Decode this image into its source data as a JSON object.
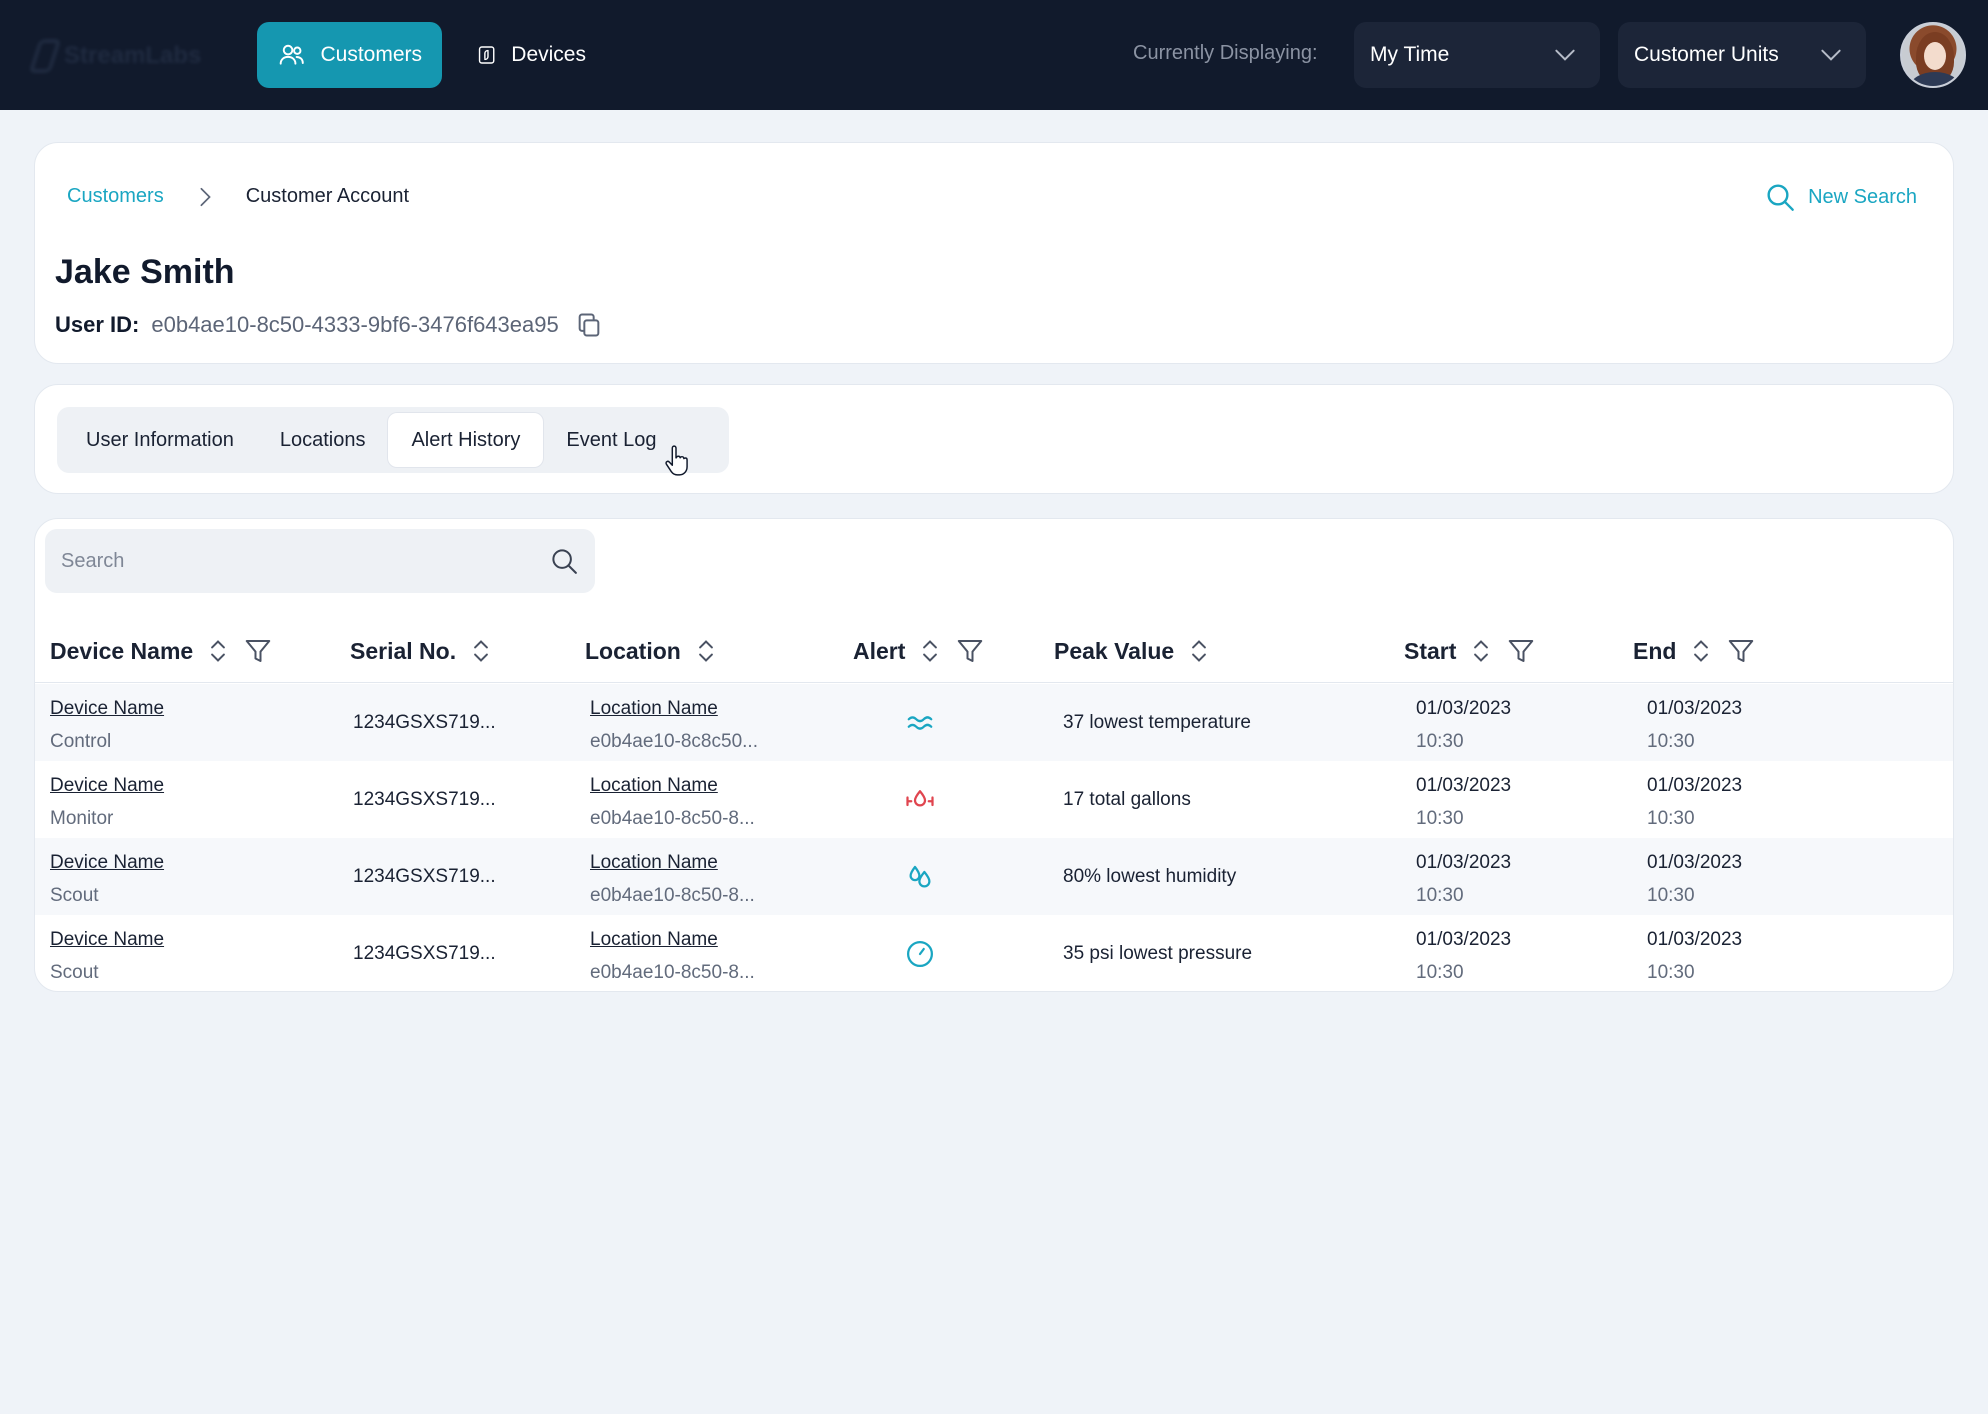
{
  "brand": {
    "name": "StreamLabs"
  },
  "topbar": {
    "nav": [
      {
        "label": "Customers",
        "icon": "users-icon",
        "active": true
      },
      {
        "label": "Devices",
        "icon": "device-icon",
        "active": false
      }
    ],
    "displaying_label": "Currently Displaying:",
    "time_select": "My Time",
    "units_select": "Customer Units"
  },
  "breadcrumb": {
    "parent": "Customers",
    "current": "Customer Account"
  },
  "new_search": "New Search",
  "customer": {
    "name": "Jake Smith",
    "user_id_label": "User ID:",
    "user_id": "e0b4ae10-8c50-4333-9bf6-3476f643ea95"
  },
  "tabs": [
    "User Information",
    "Locations",
    "Alert History",
    "Event Log"
  ],
  "active_tab": "Alert History",
  "table": {
    "search_placeholder": "Search",
    "columns": [
      "Device Name",
      "Serial No.",
      "Location",
      "Alert",
      "Peak Value",
      "Start",
      "End"
    ],
    "rows": [
      {
        "device": "Device Name",
        "type": "Control",
        "serial": "1234GSXS719...",
        "location": "Location Name",
        "location_id": "e0b4ae10-8c8c50...",
        "alert": "temperature-icon",
        "peak": "37 lowest temperature",
        "start_date": "01/03/2023",
        "start_time": "10:30",
        "end_date": "01/03/2023",
        "end_time": "10:30"
      },
      {
        "device": "Device Name",
        "type": "Monitor",
        "serial": "1234GSXS719...",
        "location": "Location Name",
        "location_id": "e0b4ae10-8c50-8...",
        "alert": "water-flow-icon",
        "peak": "17 total gallons",
        "start_date": "01/03/2023",
        "start_time": "10:30",
        "end_date": "01/03/2023",
        "end_time": "10:30"
      },
      {
        "device": "Device Name",
        "type": "Scout",
        "serial": "1234GSXS719...",
        "location": "Location Name",
        "location_id": "e0b4ae10-8c50-8...",
        "alert": "humidity-icon",
        "peak": "80% lowest humidity",
        "start_date": "01/03/2023",
        "start_time": "10:30",
        "end_date": "01/03/2023",
        "end_time": "10:30"
      },
      {
        "device": "Device Name",
        "type": "Scout",
        "serial": "1234GSXS719...",
        "location": "Location Name",
        "location_id": "e0b4ae10-8c50-8...",
        "alert": "pressure-icon",
        "peak": "35 psi lowest pressure",
        "start_date": "01/03/2023",
        "start_time": "10:30",
        "end_date": "01/03/2023",
        "end_time": "10:30"
      }
    ]
  },
  "colors": {
    "accent": "#1597b0",
    "link": "#1aa6c2",
    "topbar": "#111a2c",
    "alert_red": "#e0454f"
  }
}
